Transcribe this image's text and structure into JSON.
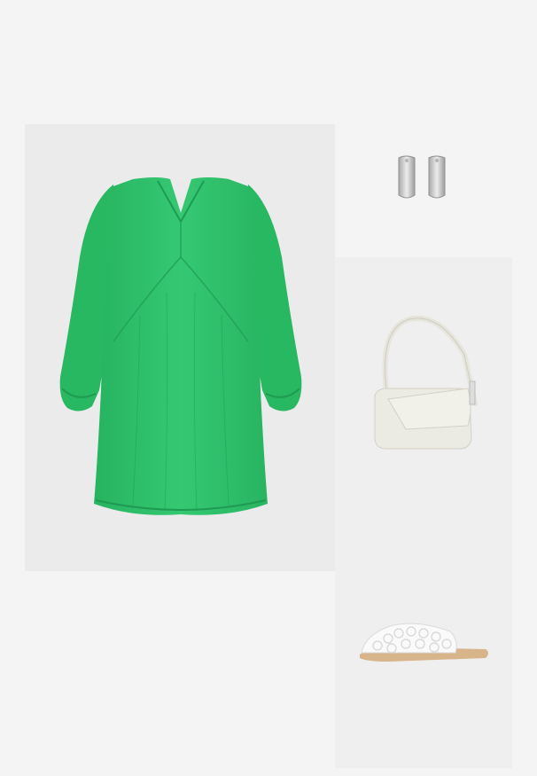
{
  "outfit": {
    "items": [
      {
        "product": "green-tunic-dress",
        "background": "#ebebeb",
        "garment_color": "#2fc46c"
      },
      {
        "product": "silver-earrings",
        "background": "#f4f4f4",
        "metal_color": "#c9c9c9"
      },
      {
        "product": "cream-shoulder-bag",
        "background": "#efefef",
        "leather_color": "#ecebe3"
      },
      {
        "product": "white-woven-mule",
        "background": "#efefef",
        "strap_color": "#fafafa",
        "sole_color": "#d7b48a"
      }
    ]
  }
}
